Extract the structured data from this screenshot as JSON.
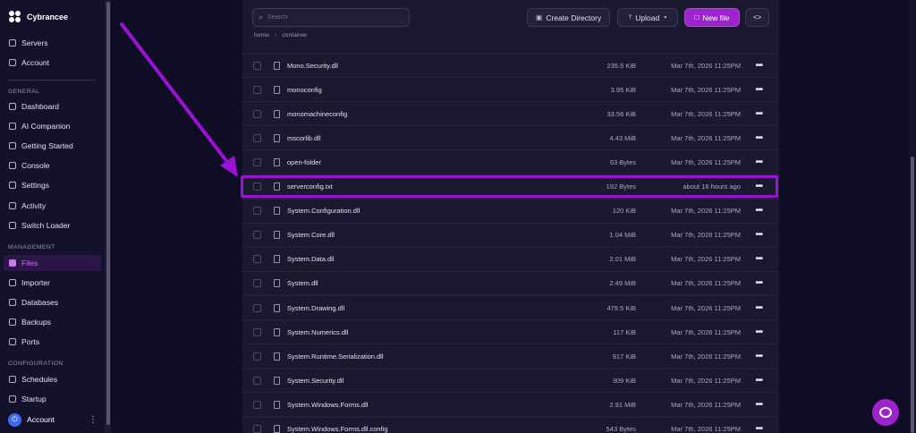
{
  "sidebar": {
    "brand": "Cybrancee",
    "top_items": [
      {
        "label": "Servers",
        "icon": "server-icon"
      },
      {
        "label": "Account",
        "icon": "account-icon"
      }
    ],
    "sections": [
      {
        "title": "GENERAL",
        "items": [
          {
            "label": "Dashboard",
            "icon": "dashboard-icon"
          },
          {
            "label": "AI Companion",
            "icon": "ai-icon"
          },
          {
            "label": "Getting Started",
            "icon": "compass-icon"
          },
          {
            "label": "Console",
            "icon": "terminal-icon"
          },
          {
            "label": "Settings",
            "icon": "gear-icon"
          },
          {
            "label": "Activity",
            "icon": "activity-icon"
          },
          {
            "label": "Switch Loader",
            "icon": "switch-icon"
          }
        ]
      },
      {
        "title": "MANAGEMENT",
        "items": [
          {
            "label": "Files",
            "icon": "folder-icon"
          },
          {
            "label": "Importer",
            "icon": "import-icon"
          },
          {
            "label": "Databases",
            "icon": "database-icon"
          },
          {
            "label": "Backups",
            "icon": "archive-icon"
          },
          {
            "label": "Ports",
            "icon": "network-icon"
          }
        ]
      },
      {
        "title": "CONFIGURATION",
        "items": [
          {
            "label": "Schedules",
            "icon": "calendar-icon"
          },
          {
            "label": "Startup",
            "icon": "play-icon"
          }
        ]
      }
    ],
    "active_item": "Files",
    "account_label": "Account"
  },
  "toolbar": {
    "search_placeholder": "Search",
    "create_directory": "Create Directory",
    "upload": "Upload",
    "new_file": "New file"
  },
  "breadcrumb": [
    "home",
    "container"
  ],
  "files": [
    {
      "name": "Mono.Security.dll",
      "size": "235.5 KiB",
      "modified": "Mar 7th, 2026 11:25PM"
    },
    {
      "name": "monoconfig",
      "size": "3.95 KiB",
      "modified": "Mar 7th, 2026 11:25PM"
    },
    {
      "name": "monomachineconfig",
      "size": "33.56 KiB",
      "modified": "Mar 7th, 2026 11:25PM"
    },
    {
      "name": "mscorlib.dll",
      "size": "4.43 MiB",
      "modified": "Mar 7th, 2026 11:25PM"
    },
    {
      "name": "open-folder",
      "size": "63 Bytes",
      "modified": "Mar 7th, 2026 11:25PM"
    },
    {
      "name": "serverconfig.txt",
      "size": "192 Bytes",
      "modified": "about 16 hours ago",
      "highlighted": true
    },
    {
      "name": "System.Configuration.dll",
      "size": "120 KiB",
      "modified": "Mar 7th, 2026 11:25PM"
    },
    {
      "name": "System.Core.dll",
      "size": "1.04 MiB",
      "modified": "Mar 7th, 2026 11:25PM"
    },
    {
      "name": "System.Data.dll",
      "size": "2.01 MiB",
      "modified": "Mar 7th, 2026 11:25PM"
    },
    {
      "name": "System.dll",
      "size": "2.49 MiB",
      "modified": "Mar 7th, 2026 11:25PM"
    },
    {
      "name": "System.Drawing.dll",
      "size": "479.5 KiB",
      "modified": "Mar 7th, 2026 11:25PM"
    },
    {
      "name": "System.Numerics.dll",
      "size": "117 KiB",
      "modified": "Mar 7th, 2026 11:25PM"
    },
    {
      "name": "System.Runtime.Serialization.dll",
      "size": "917 KiB",
      "modified": "Mar 7th, 2026 11:25PM"
    },
    {
      "name": "System.Security.dll",
      "size": "309 KiB",
      "modified": "Mar 7th, 2026 11:25PM"
    },
    {
      "name": "System.Windows.Forms.dll",
      "size": "2.91 MiB",
      "modified": "Mar 7th, 2026 11:25PM"
    },
    {
      "name": "System.Windows.Forms.dll.config",
      "size": "543 Bytes",
      "modified": "Mar 7th, 2026 11:25PM"
    }
  ],
  "colors": {
    "accent": "#9d23cc",
    "highlight_border": "#9c11d6",
    "background": "#0f0d25",
    "panel": "#1b1930"
  }
}
